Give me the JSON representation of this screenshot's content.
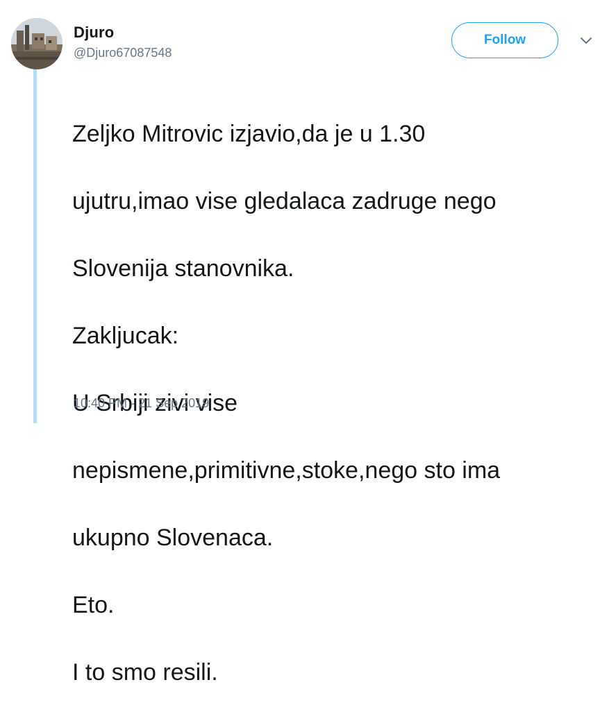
{
  "user": {
    "name": "Djuro",
    "handle": "@Djuro67087548"
  },
  "follow_button": {
    "label": "Follow"
  },
  "tweet": {
    "lines": [
      "Zeljko Mitrovic izjavio,da je u 1.30",
      "ujutru,imao vise gledalaca zadruge nego",
      "Slovenija stanovnika.",
      "Zakljucak:",
      "U Srbiji zivi vise",
      "nepismene,primitivne,stoke,nego sto ima",
      "ukupno Slovenaca.",
      "Eto.",
      "I to smo resili."
    ],
    "timestamp": "10:40 PM - 21 Sep 2019"
  },
  "colors": {
    "accent": "#1da1f2",
    "thread_line": "#b3dcf7",
    "text": "#14171a",
    "secondary_text": "#657786"
  },
  "icons": {
    "avatar": "profile-photo",
    "menu": "chevron-down-icon"
  }
}
